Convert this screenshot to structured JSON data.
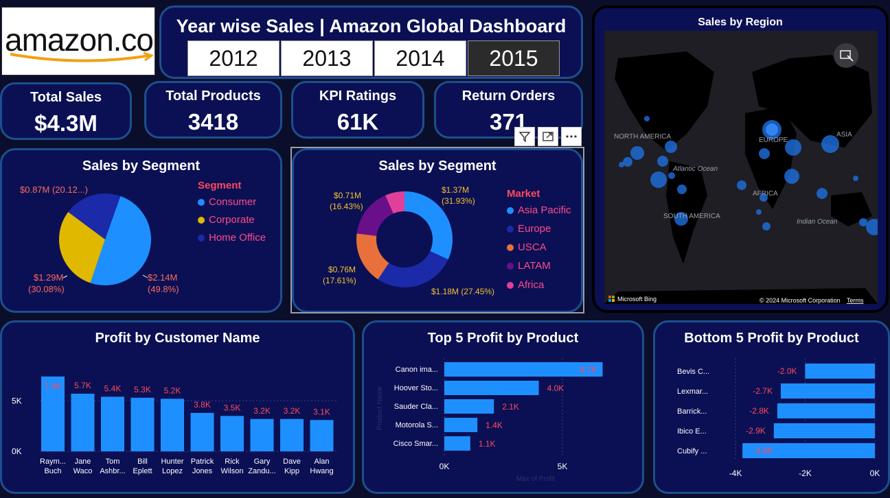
{
  "logo": {
    "text": "amazon.com"
  },
  "header": {
    "title": "Year wise Sales | Amazon Global Dashboard",
    "years": [
      "2012",
      "2013",
      "2014",
      "2015"
    ],
    "selected_year": "2015"
  },
  "kpis": {
    "total_sales": {
      "label": "Total Sales",
      "value": "$4.3M"
    },
    "total_products": {
      "label": "Total Products",
      "value": "3418"
    },
    "kpi_ratings": {
      "label": "KPI Ratings",
      "value": "61K"
    },
    "return_orders": {
      "label": "Return Orders",
      "value": "371"
    }
  },
  "colors": {
    "card_bg": "#0b1054",
    "card_border": "#1d4f8f",
    "bar_blue": "#1e8fff",
    "label_red": "#ff4a5a",
    "consumer": "#1e8fff",
    "corporate": "#e0b800",
    "home_office": "#1a2aa8",
    "asia_pacific": "#1e8fff",
    "europe": "#1a2aa8",
    "usca": "#e8703a",
    "latam": "#6a0f8a",
    "africa": "#e0409a"
  },
  "map": {
    "title": "Sales by Region",
    "labels": [
      "NORTH AMERICA",
      "EUROPE",
      "ASIA",
      "Atlantic Ocean",
      "AFRICA",
      "SOUTH AMERICA",
      "Indian Ocean"
    ],
    "brand": "Microsoft Bing",
    "copyright": "© 2024 Microsoft Corporation",
    "terms": "Terms"
  },
  "chart_data": [
    {
      "type": "pie",
      "title": "Sales by Segment",
      "legend_title": "Segment",
      "slices": [
        {
          "name": "Consumer",
          "value": 2.14,
          "label": "$2.14M",
          "pct": "(49.8%)"
        },
        {
          "name": "Corporate",
          "value": 1.29,
          "label": "$1.29M",
          "pct": "(30.08%)"
        },
        {
          "name": "Home Office",
          "value": 0.87,
          "label": "$0.87M (20.12...)",
          "pct": ""
        }
      ]
    },
    {
      "type": "donut",
      "title": "Sales by Segment",
      "legend_title": "Market",
      "slices": [
        {
          "name": "Asia Pacific",
          "value": 1.37,
          "label": "$1.37M",
          "pct": "(31.93%)"
        },
        {
          "name": "Europe",
          "value": 1.18,
          "label": "$1.18M (27.45%)",
          "pct": ""
        },
        {
          "name": "USCA",
          "value": 0.76,
          "label": "$0.76M",
          "pct": "(17.61%)"
        },
        {
          "name": "LATAM",
          "value": 0.71,
          "label": "$0.71M",
          "pct": "(16.43%)"
        },
        {
          "name": "Africa",
          "value": 0.28,
          "label": "",
          "pct": ""
        }
      ]
    },
    {
      "type": "bar",
      "title": "Profit by Customer Name",
      "categories": [
        "Raym... Buch",
        "Jane Waco",
        "Tom Ashbr...",
        "Bill Eplett",
        "Hunter Lopez",
        "Patrick Jones",
        "Rick Wilson",
        "Gary Zandu...",
        "Dave Kipp",
        "Alan Hwang"
      ],
      "values": [
        7.4,
        5.7,
        5.4,
        5.3,
        5.2,
        3.8,
        3.5,
        3.2,
        3.2,
        3.1
      ],
      "value_labels": [
        "7.4K",
        "5.7K",
        "5.4K",
        "5.3K",
        "5.2K",
        "3.8K",
        "3.5K",
        "3.2K",
        "3.2K",
        "3.1K"
      ],
      "yticks": [
        "0K",
        "5K"
      ],
      "ylim": [
        0,
        8
      ]
    },
    {
      "type": "bar",
      "orientation": "horizontal",
      "title": "Top 5 Profit by Product",
      "categories": [
        "Canon ima...",
        "Hoover Sto...",
        "Sauder Cla...",
        "Motorola S...",
        "Cisco Smar..."
      ],
      "values": [
        6.7,
        4.0,
        2.1,
        1.4,
        1.1
      ],
      "value_labels": [
        "6.7K",
        "4.0K",
        "2.1K",
        "1.4K",
        "1.1K"
      ],
      "xticks": [
        "0K",
        "5K"
      ],
      "xlim": [
        0,
        7.5
      ],
      "xlabel": "Max of Profit",
      "ylabel": "Product Name"
    },
    {
      "type": "bar",
      "orientation": "horizontal",
      "title": "Bottom 5 Profit by Product",
      "categories": [
        "Bevis C...",
        "Lexmar...",
        "Barrick...",
        "Ibico E...",
        "Cubify ..."
      ],
      "values": [
        -2.0,
        -2.7,
        -2.8,
        -2.9,
        -3.8
      ],
      "value_labels": [
        "-2.0K",
        "-2.7K",
        "-2.8K",
        "-2.9K",
        "-3.8K"
      ],
      "xticks": [
        "-4K",
        "-2K",
        "0K"
      ],
      "xlim": [
        -4,
        0
      ]
    }
  ]
}
